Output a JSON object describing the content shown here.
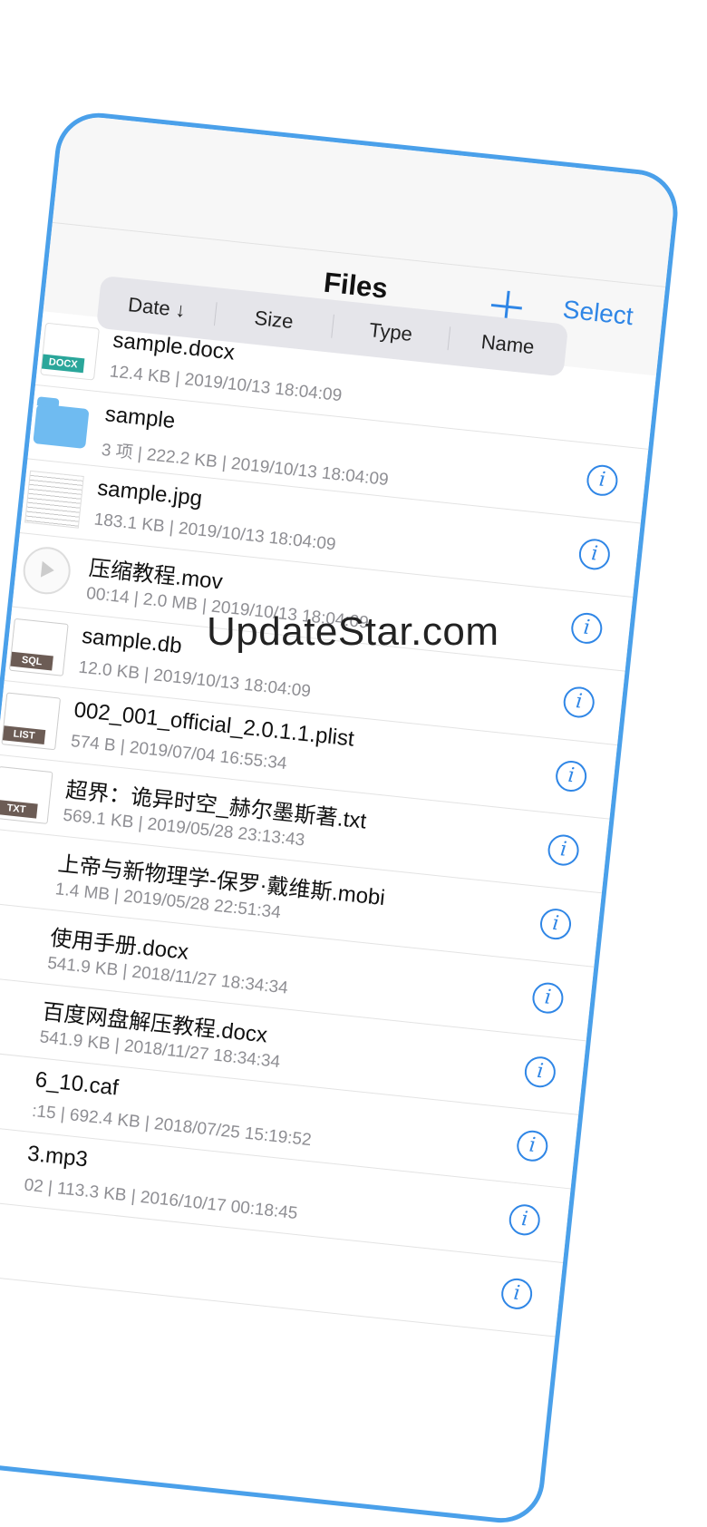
{
  "nav": {
    "title": "Files",
    "add_icon": "plus-icon",
    "select_label": "Select"
  },
  "sort": {
    "options": [
      "Date ↓",
      "Size",
      "Type",
      "Name"
    ]
  },
  "files": [
    {
      "name": "sample.docx",
      "meta": "12.4 KB | 2019/10/13 18:04:09",
      "thumb": "docx",
      "tag": "DOCX"
    },
    {
      "name": "sample",
      "meta": "3 项 | 222.2 KB | 2019/10/13 18:04:09",
      "thumb": "folder",
      "tag": ""
    },
    {
      "name": "sample.jpg",
      "meta": "183.1 KB | 2019/10/13 18:04:09",
      "thumb": "jpg",
      "tag": ""
    },
    {
      "name": "压缩教程.mov",
      "meta": "00:14 | 2.0 MB | 2019/10/13 18:04:09",
      "thumb": "mov",
      "tag": ""
    },
    {
      "name": "sample.db",
      "meta": "12.0 KB | 2019/10/13 18:04:09",
      "thumb": "doc",
      "tag": "SQL"
    },
    {
      "name": "002_001_official_2.0.1.1.plist",
      "meta": "574 B | 2019/07/04 16:55:34",
      "thumb": "doc",
      "tag": "LIST"
    },
    {
      "name": "超界：诡异时空_赫尔墨斯著.txt",
      "meta": "569.1 KB | 2019/05/28 23:13:43",
      "thumb": "doc",
      "tag": "TXT"
    },
    {
      "name": "上帝与新物理学-保罗·戴维斯.mobi",
      "meta": "1.4 MB | 2019/05/28 22:51:34",
      "thumb": "blank",
      "tag": ""
    },
    {
      "name": "使用手册.docx",
      "meta": "541.9 KB | 2018/11/27 18:34:34",
      "thumb": "blank",
      "tag": ""
    },
    {
      "name": "百度网盘解压教程.docx",
      "meta": "541.9 KB | 2018/11/27 18:34:34",
      "thumb": "blank",
      "tag": ""
    },
    {
      "name": "6_10.caf",
      "meta": ":15 | 692.4 KB | 2018/07/25 15:19:52",
      "thumb": "blank",
      "tag": ""
    },
    {
      "name": "3.mp3",
      "meta": "02 | 113.3 KB | 2016/10/17 00:18:45",
      "thumb": "blank",
      "tag": ""
    },
    {
      "name": "",
      "meta": "",
      "thumb": "blank",
      "tag": ""
    }
  ],
  "watermark": "UpdateStar.com",
  "colors": {
    "accent": "#2f86e6",
    "frame": "#4aa0ea"
  }
}
